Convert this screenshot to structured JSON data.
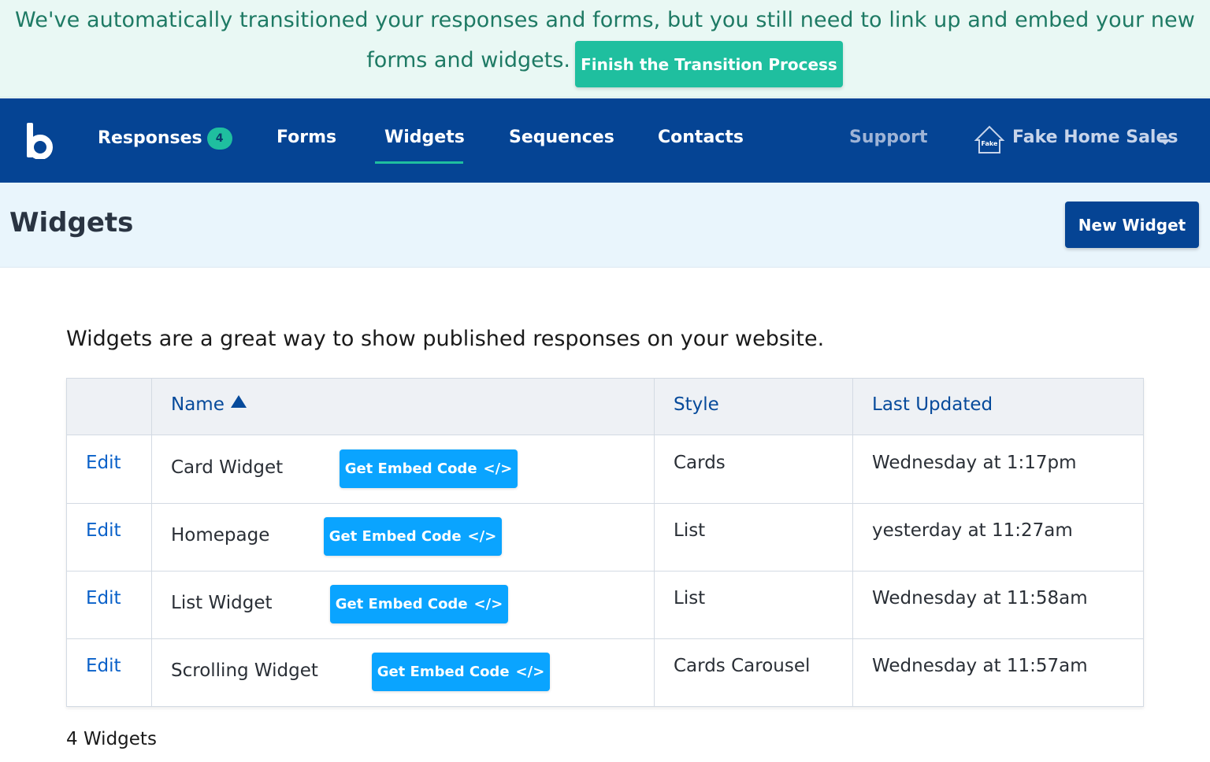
{
  "banner": {
    "line1": "We've automatically transitioned your responses and forms, but you still need to link up and embed your new",
    "line2": "forms and widgets.",
    "button_label": "Finish the Transition Process"
  },
  "nav": {
    "logo_letter": "b",
    "items": [
      {
        "label": "Responses",
        "badge": "4"
      },
      {
        "label": "Forms"
      },
      {
        "label": "Widgets",
        "active": true
      },
      {
        "label": "Sequences"
      },
      {
        "label": "Contacts"
      }
    ],
    "support_label": "Support",
    "account_name": "Fake Home Sales",
    "account_logo_text": "Fake"
  },
  "header": {
    "title": "Widgets",
    "new_button": "New Widget"
  },
  "intro_text": "Widgets are a great way to show published responses on your website.",
  "table": {
    "columns": {
      "name": "Name",
      "style": "Style",
      "updated": "Last Updated"
    },
    "embed_label": "Get Embed Code",
    "embed_icon": "</>",
    "edit_label": "Edit",
    "rows": [
      {
        "name": "Card Widget",
        "style": "Cards",
        "updated": "Wednesday at 1:17pm"
      },
      {
        "name": "Homepage",
        "style": "List",
        "updated": "yesterday at 11:27am"
      },
      {
        "name": "List Widget",
        "style": "List",
        "updated": "Wednesday at 11:58am"
      },
      {
        "name": "Scrolling Widget",
        "style": "Cards Carousel",
        "updated": "Wednesday at 11:57am"
      }
    ]
  },
  "footer_count": "4 Widgets",
  "colors": {
    "nav_bg": "#054494",
    "accent_teal": "#1fbf9f",
    "embed_blue": "#0aa4ff",
    "banner_bg": "#e9f8f4"
  }
}
